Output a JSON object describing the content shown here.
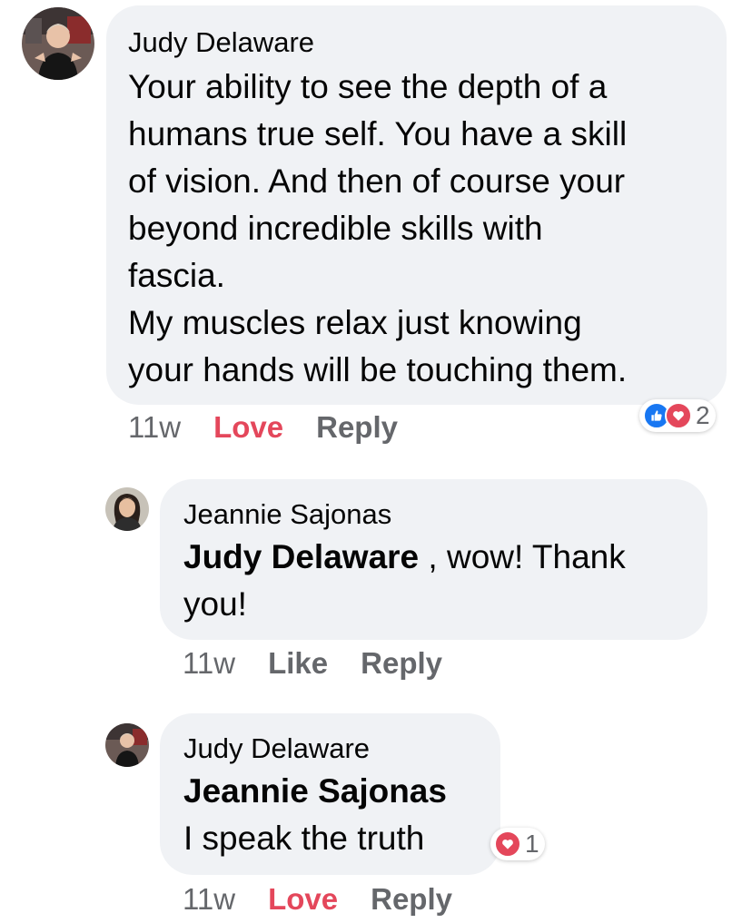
{
  "colors": {
    "bubble_bg": "#f0f2f5",
    "meta_text": "#65676b",
    "love_red": "#e4475b",
    "like_blue": "#1877f2"
  },
  "comments": [
    {
      "author": "Judy Delaware",
      "avatar_icon": "user-avatar-photo",
      "text_lines": [
        "Your ability to see the depth of a",
        "humans true self. You have a skill",
        "of vision. And then of course your",
        "beyond incredible skills with",
        "fascia.",
        "My muscles relax just knowing",
        "your hands will be touching them."
      ],
      "time": "11w",
      "reaction_action": "Love",
      "reply_label": "Reply",
      "reactions": {
        "icons": [
          "like-icon",
          "love-icon"
        ],
        "count": "2"
      }
    },
    {
      "author": "Jeannie Sajonas",
      "avatar_icon": "user-avatar-photo",
      "mention": "Judy Delaware",
      "text_after_mention": " , wow! Thank",
      "text_line2": "you!",
      "time": "11w",
      "reaction_action": "Like",
      "reply_label": "Reply"
    },
    {
      "author": "Judy Delaware",
      "avatar_icon": "user-avatar-photo",
      "mention": "Jeannie Sajonas",
      "text": "I speak the truth",
      "time": "11w",
      "reaction_action": "Love",
      "reply_label": "Reply",
      "reactions": {
        "icons": [
          "love-icon"
        ],
        "count": "1"
      }
    }
  ]
}
